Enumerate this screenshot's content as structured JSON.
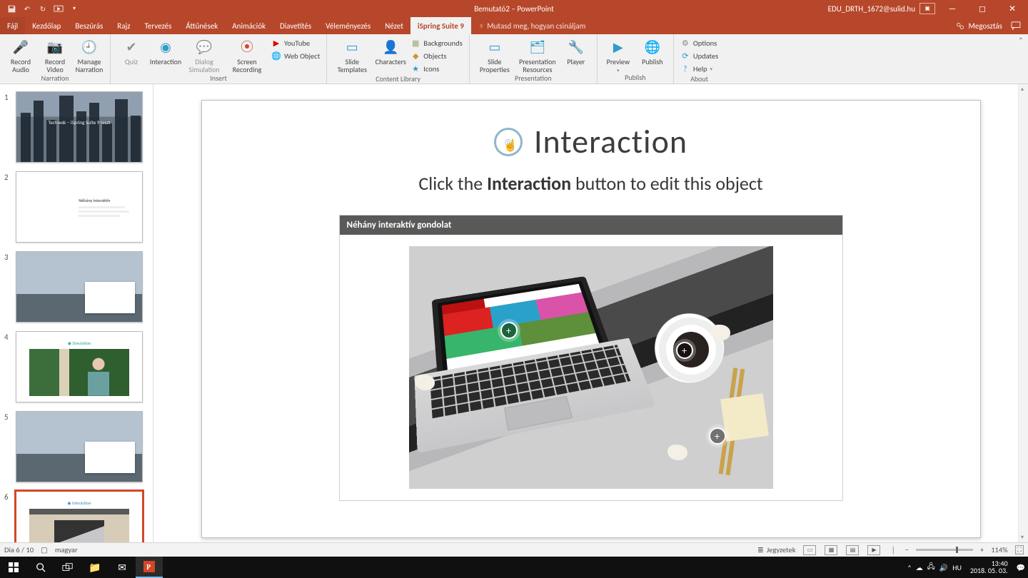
{
  "titlebar": {
    "doc_title": "Bemutató2 – PowerPoint",
    "account": "EDU_DRTH_1672@sulid.hu"
  },
  "tabs": {
    "items": [
      "Fájl",
      "Kezdőlap",
      "Beszúrás",
      "Rajz",
      "Tervezés",
      "Áttűnések",
      "Animációk",
      "Diavetítés",
      "Véleményezés",
      "Nézet",
      "iSpring Suite 9"
    ],
    "active_index": 10,
    "tell_me": "Mutasd meg, hogyan csináljam",
    "share": "Megosztás"
  },
  "ribbon": {
    "narration": {
      "record_audio": "Record Audio",
      "record_video": "Record Video",
      "manage": "Manage Narration",
      "label": "Narration"
    },
    "insert": {
      "quiz": "Quiz",
      "interaction": "Interaction",
      "dialog": "Dialog Simulation",
      "screen": "Screen Recording",
      "youtube": "YouTube",
      "webobj": "Web Object",
      "label": "Insert"
    },
    "content": {
      "slide_tmpl": "Slide Templates",
      "characters": "Characters",
      "backgrounds": "Backgrounds",
      "objects": "Objects",
      "icons": "Icons",
      "label": "Content Library"
    },
    "presentation": {
      "slide_props": "Slide Properties",
      "pres_res": "Presentation Resources",
      "player": "Player",
      "label": "Presentation"
    },
    "publish": {
      "preview": "Preview",
      "publish": "Publish",
      "label": "Publish"
    },
    "about": {
      "options": "Options",
      "updates": "Updates",
      "help": "Help",
      "label": "About"
    }
  },
  "slide": {
    "heading": "Interaction",
    "sub_pre": "Click the ",
    "sub_bold": "Interaction",
    "sub_post": " button to edit this object",
    "viewer_title": "Néhány interaktív gondolat"
  },
  "thumbs": {
    "t1_title": "Techwok – iSpring Suite 9 teszt",
    "t2_title": "Néhány interaktív",
    "count": 6
  },
  "statusbar": {
    "slide": "Dia 6 / 10",
    "lang": "magyar",
    "notes": "Jegyzetek",
    "zoom": "114%"
  },
  "taskbar": {
    "time": "13:40",
    "date": "2018. 05. 03."
  }
}
